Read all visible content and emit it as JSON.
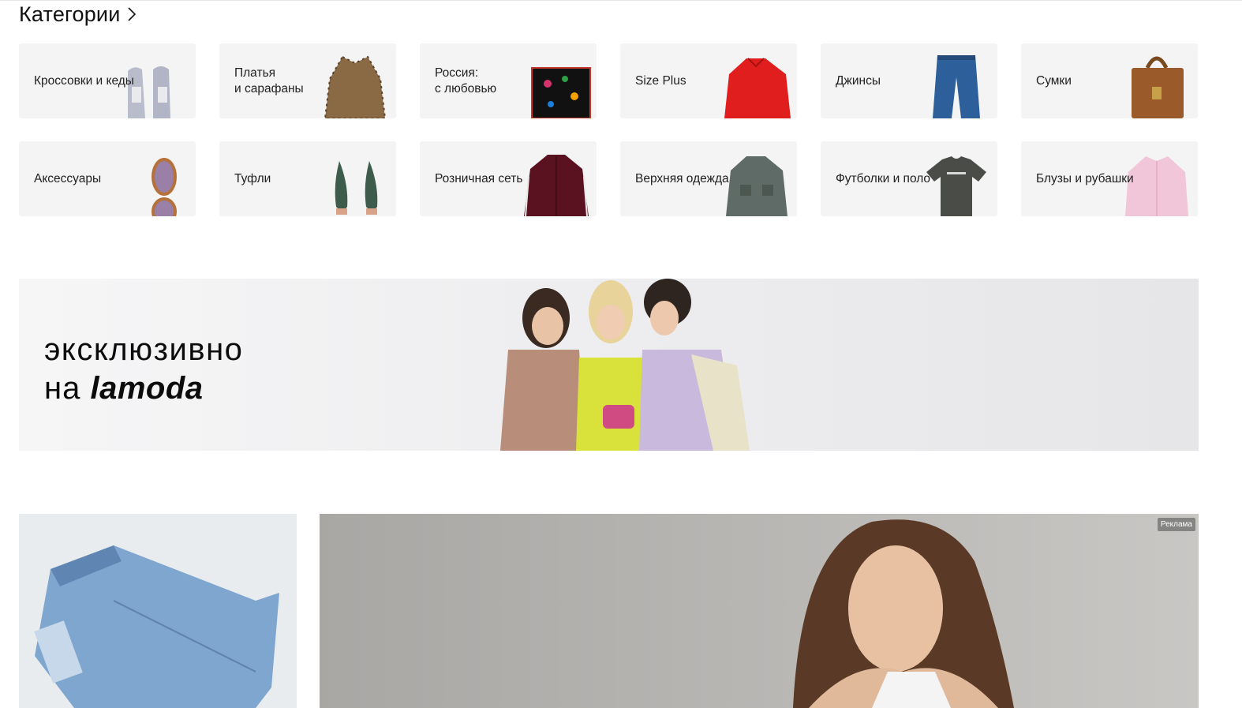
{
  "categories": {
    "title": "Категории",
    "items": [
      {
        "label": "Кроссовки и кеды",
        "icon": "sneakers-icon"
      },
      {
        "label": "Платья\nи сарафаны",
        "icon": "dress-icon"
      },
      {
        "label": "Россия:\nс любовью",
        "icon": "scarf-icon"
      },
      {
        "label": "Size Plus",
        "icon": "sweater-icon"
      },
      {
        "label": "Джинсы",
        "icon": "jeans-icon"
      },
      {
        "label": "Сумки",
        "icon": "bag-icon"
      },
      {
        "label": "Аксессуары",
        "icon": "sunglasses-icon"
      },
      {
        "label": "Туфли",
        "icon": "shoes-icon"
      },
      {
        "label": "Розничная сеть",
        "icon": "track-jacket-icon"
      },
      {
        "label": "Верхняя одежда",
        "icon": "parka-icon"
      },
      {
        "label": "Футболки и поло",
        "icon": "tshirt-icon"
      },
      {
        "label": "Блузы и рубашки",
        "icon": "shirt-icon"
      }
    ]
  },
  "promo": {
    "line1": "эксклюзивно",
    "line2_prefix": "на",
    "line2_brand": "lamoda"
  },
  "ad": {
    "badge": "Реклама"
  },
  "colors": {
    "card_bg": "#f4f4f4",
    "text": "#1f1f1f"
  }
}
